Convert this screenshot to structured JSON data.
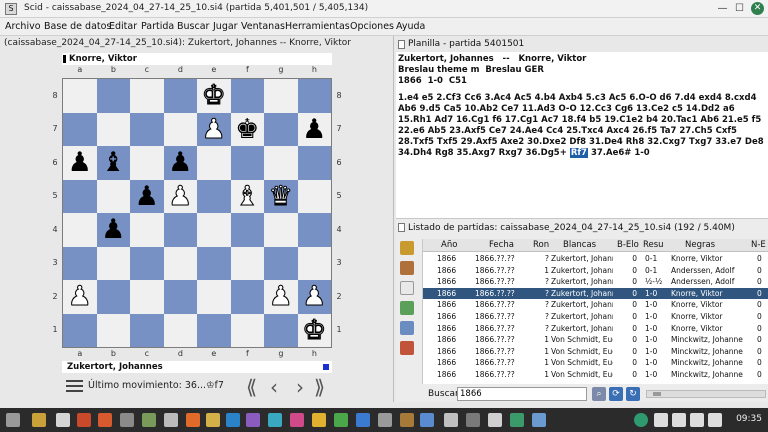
{
  "window": {
    "app_icon": "S",
    "title": "Scid - caissabase_2024_04_27-14_25_10.si4 (partida 5,401,501 / 5,405,134)",
    "controls": [
      "minimize-icon",
      "maximize-icon",
      "close-icon"
    ]
  },
  "menu": [
    "Archivo",
    "Base de datos",
    "Editar",
    "Partida",
    "Buscar",
    "Jugar",
    "Ventanas",
    "Herramientas",
    "Opciones",
    "Ayuda"
  ],
  "board_pane": {
    "header": "(caissabase_2024_04_27-14_25_10.si4): Zukertort, Johannes -- Knorre, Viktor",
    "top_player": "Knorre, Viktor",
    "bottom_player": "Zukertort, Johannes",
    "side_to_move_color": "#1a2fd0",
    "files": [
      "a",
      "b",
      "c",
      "d",
      "e",
      "f",
      "g",
      "h"
    ],
    "ranks": [
      "8",
      "7",
      "6",
      "5",
      "4",
      "3",
      "2",
      "1"
    ],
    "colors": {
      "light": "#f0f0f0",
      "dark": "#7891c5"
    },
    "pieces": [
      {
        "sq": "e8",
        "glyph": "♚",
        "color": "w"
      },
      {
        "sq": "e7",
        "glyph": "♟",
        "color": "w"
      },
      {
        "sq": "f7",
        "glyph": "♚",
        "color": "b"
      },
      {
        "sq": "h7",
        "glyph": "♟",
        "color": "b"
      },
      {
        "sq": "a6",
        "glyph": "♟",
        "color": "b"
      },
      {
        "sq": "b6",
        "glyph": "♝",
        "color": "b"
      },
      {
        "sq": "d6",
        "glyph": "♟",
        "color": "b"
      },
      {
        "sq": "c5",
        "glyph": "♟",
        "color": "b"
      },
      {
        "sq": "d5",
        "glyph": "♟",
        "color": "w"
      },
      {
        "sq": "f5",
        "glyph": "♝",
        "color": "w"
      },
      {
        "sq": "g5",
        "glyph": "♛",
        "color": "w"
      },
      {
        "sq": "b4",
        "glyph": "♟",
        "color": "b"
      },
      {
        "sq": "a2",
        "glyph": "♟",
        "color": "w"
      },
      {
        "sq": "g2",
        "glyph": "♟",
        "color": "w"
      },
      {
        "sq": "h2",
        "glyph": "♟",
        "color": "w"
      },
      {
        "sq": "h1",
        "glyph": "♚",
        "color": "w"
      }
    ],
    "last_move": "Último movimiento: 36...♔f7",
    "nav": [
      "⟪",
      "‹",
      "›",
      "⟫"
    ]
  },
  "pgn": {
    "tab": "Planilla - partida 5401501",
    "white_black": "Zukertort, Johannes   --   Knorre, Viktor",
    "event": "Breslau theme m  Breslau GER",
    "info": "1866  1-0  C51",
    "moves_before": "1.e4 e5 2.Cf3 Cc6 3.Ac4 Ac5 4.b4 Axb4 5.c3 Ac5 6.O-O d6 7.d4 exd4 8.cxd4 Ab6 9.d5 Ca5 10.Ab2 Ce7 11.Ad3 O-O 12.Cc3 Cg6 13.Ce2 c5 14.Dd2 a6 15.Rh1 Ad7 16.Cg1 f6 17.Cg1 Ac7 18.f4 b5 19.C1e2 b4 20.Tac1 Ab6 21.e5 f5 22.e6 Ab5 23.Axf5 Ce7 24.Ae4 Cc4 25.Txc4 Axc4 26.f5 Ta7 27.Ch5 Cxf5 28.Txf5 Txf5 29.Axf5 Axe2 30.Dxe2 Df8 31.De4 Rh8 32.Cxg7 Txg7 33.e7 De8 34.Dh4 Rg8 35.Axg7 Rxg7 36.Dg5+",
    "current_move": "Rf7",
    "moves_after": " 37.Ae6# 1-0"
  },
  "game_list": {
    "tab": "Listado de partidas: caissabase_2024_04_27-14_25_10.si4 (192 / 5.40M)",
    "columns": [
      "Año",
      "Fecha",
      "Ron",
      "Blancas",
      "B-Elo",
      "Resu",
      "Negras",
      "N-E"
    ],
    "rows": [
      [
        "1866",
        "1866.??.??",
        "?",
        "Zukertort, Johanne",
        "0",
        "0-1",
        "Knorre, Viktor",
        "0"
      ],
      [
        "1866",
        "1866.??.??",
        "1",
        "Zukertort, Johanne",
        "0",
        "0-1",
        "Anderssen, Adolf",
        "0"
      ],
      [
        "1866",
        "1866.??.??",
        "?",
        "Zukertort, Johanne",
        "0",
        "½-½",
        "Anderssen, Adolf",
        "0"
      ],
      [
        "1866",
        "1866.??.??",
        "?",
        "Zukertort, Johanne",
        "0",
        "1-0",
        "Knorre, Viktor",
        "0"
      ],
      [
        "1866",
        "1866.??.??",
        "?",
        "Zukertort, Johanne",
        "0",
        "1-0",
        "Knorre, Viktor",
        "0"
      ],
      [
        "1866",
        "1866.??.??",
        "?",
        "Zukertort, Johanne",
        "0",
        "1-0",
        "Knorre, Viktor",
        "0"
      ],
      [
        "1866",
        "1866.??.??",
        "?",
        "Zukertort, Johanne",
        "0",
        "1-0",
        "Knorre, Viktor",
        "0"
      ],
      [
        "1866",
        "1866.??.??",
        "1",
        "Von Schmidt, Eug",
        "0",
        "1-0",
        "Minckwitz, Johanne",
        "0"
      ],
      [
        "1866",
        "1866.??.??",
        "1",
        "Von Schmidt, Eug",
        "0",
        "1-0",
        "Minckwitz, Johanne",
        "0"
      ],
      [
        "1866",
        "1866.??.??",
        "1",
        "Von Schmidt, Eug",
        "0",
        "1-0",
        "Minckwitz, Johanne",
        "0"
      ],
      [
        "1866",
        "1866.??.??",
        "1",
        "Von Schmidt, Eug",
        "0",
        "1-0",
        "Minckwitz, Johanne",
        "0"
      ]
    ],
    "selected_row": 3,
    "selected_color": "#30557f",
    "search_label": "Buscar",
    "search_value": "1866"
  },
  "taskbar": {
    "clock": "09:35"
  }
}
